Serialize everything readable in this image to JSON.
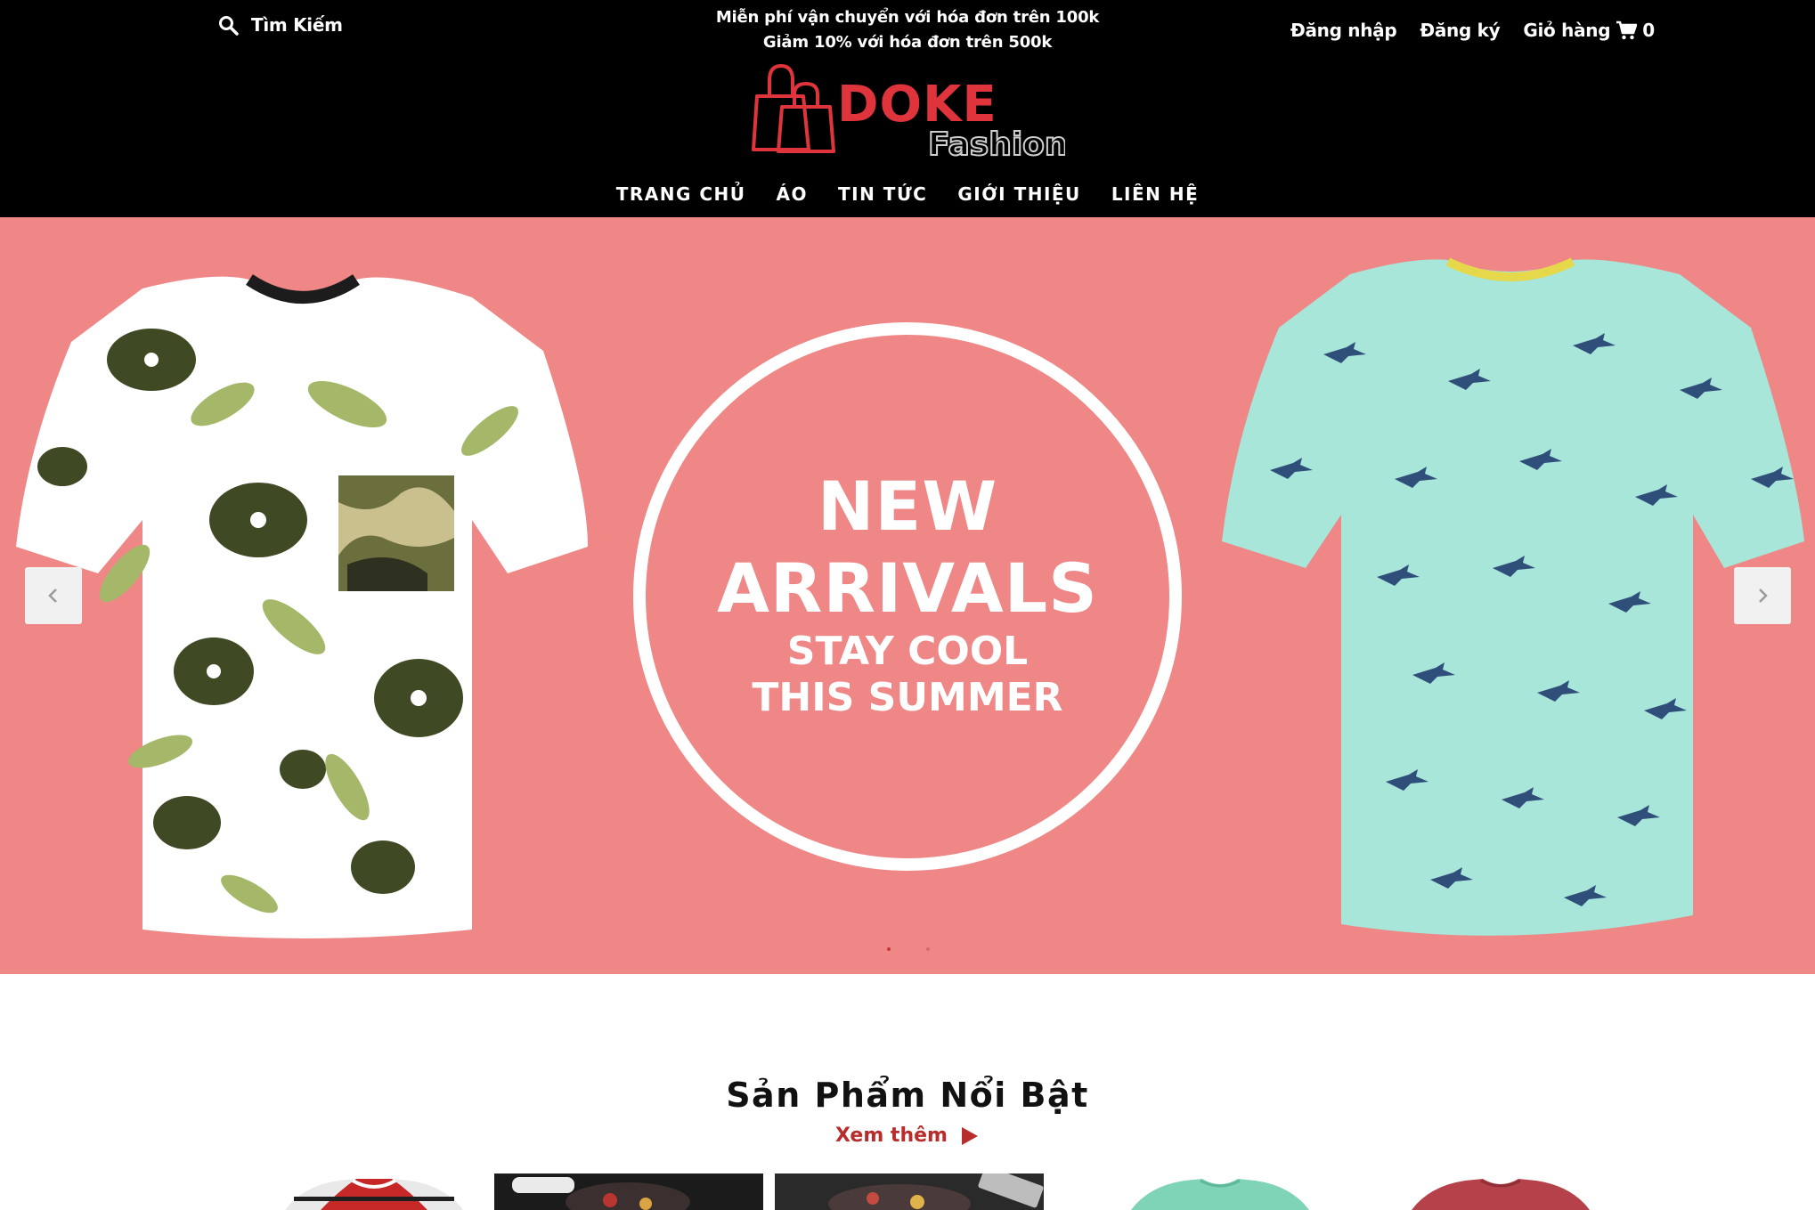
{
  "header": {
    "search_label": "Tìm Kiếm",
    "promo_line1": "Miễn phí vận chuyển với hóa đơn trên 100k",
    "promo_line2": "Giảm 10% với hóa đơn trên 500k",
    "login_label": "Đăng nhập",
    "register_label": "Đăng ký",
    "cart_label": "Giỏ hàng",
    "cart_count": "0",
    "logo": {
      "brand": "DOKE",
      "tagline": "Fashion"
    }
  },
  "nav": {
    "items": [
      {
        "label": "TRANG CHỦ"
      },
      {
        "label": "ÁO"
      },
      {
        "label": "TIN TỨC"
      },
      {
        "label": "GIỚI THIỆU"
      },
      {
        "label": "LIÊN HỆ"
      }
    ]
  },
  "hero": {
    "line1": "NEW",
    "line2": "ARRIVALS",
    "line3": "STAY COOL",
    "line4": "THIS SUMMER",
    "active_slide": 1,
    "slide_count": 2
  },
  "featured": {
    "title": "Sản Phẩm Nổi Bật",
    "see_more": "Xem thêm"
  },
  "colors": {
    "header_bg": "#000000",
    "hero_bg": "#ee8786",
    "accent": "#b82c2c",
    "logo_red": "#e0343c"
  }
}
